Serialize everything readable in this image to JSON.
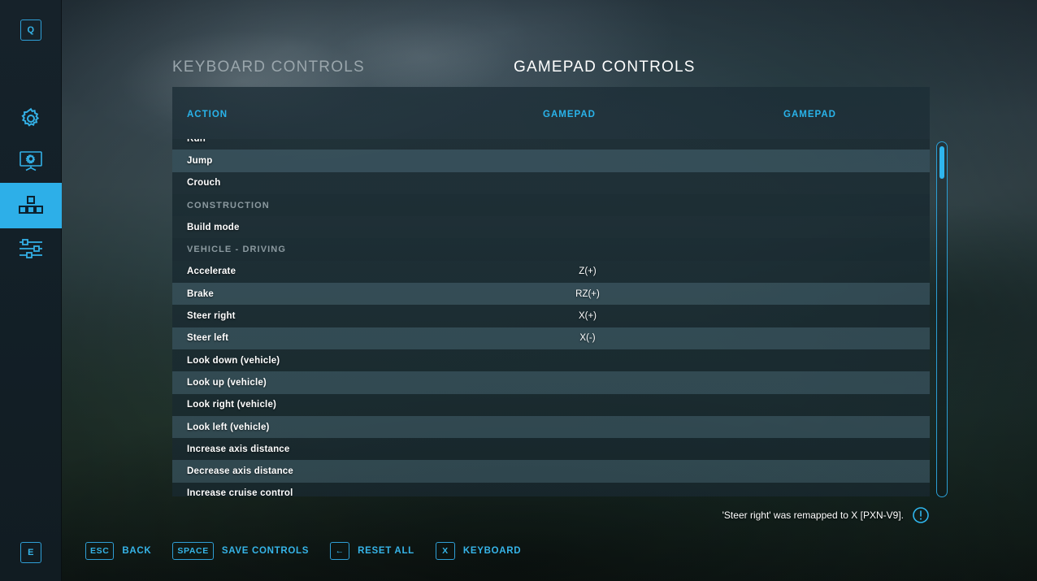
{
  "sidebar": {
    "top_key": "Q",
    "bottom_key": "E",
    "items": [
      {
        "name": "settings",
        "icon": "gear-icon",
        "active": false
      },
      {
        "name": "display",
        "icon": "monitor-gear-icon",
        "active": false
      },
      {
        "name": "controls",
        "icon": "controls-grid-icon",
        "active": true
      },
      {
        "name": "game-settings",
        "icon": "sliders-icon",
        "active": false
      }
    ]
  },
  "tabs": {
    "inactive_label": "KEYBOARD CONTROLS",
    "active_label": "GAMEPAD CONTROLS"
  },
  "table": {
    "headers": {
      "action": "ACTION",
      "gamepad_1": "GAMEPAD",
      "gamepad_2": "GAMEPAD"
    },
    "rows": [
      {
        "action": "Run",
        "value": "",
        "value2": "",
        "type": "binding",
        "shade": "dark",
        "clipped_top": true
      },
      {
        "action": "Jump",
        "value": "",
        "value2": "",
        "type": "binding",
        "shade": "lite"
      },
      {
        "action": "Crouch",
        "value": "",
        "value2": "",
        "type": "binding",
        "shade": "dark"
      },
      {
        "action": "CONSTRUCTION",
        "value": "",
        "value2": "",
        "type": "section",
        "shade": "section"
      },
      {
        "action": "Build mode",
        "value": "",
        "value2": "",
        "type": "binding",
        "shade": "dark"
      },
      {
        "action": "VEHICLE - DRIVING",
        "value": "",
        "value2": "",
        "type": "section",
        "shade": "section"
      },
      {
        "action": "Accelerate",
        "value": "Z(+)",
        "value2": "",
        "type": "binding",
        "shade": "dark"
      },
      {
        "action": "Brake",
        "value": "RZ(+)",
        "value2": "",
        "type": "binding",
        "shade": "lite"
      },
      {
        "action": "Steer right",
        "value": "X(+)",
        "value2": "",
        "type": "binding",
        "shade": "dark"
      },
      {
        "action": "Steer left",
        "value": "X(-)",
        "value2": "",
        "type": "binding",
        "shade": "lite"
      },
      {
        "action": "Look down (vehicle)",
        "value": "",
        "value2": "",
        "type": "binding",
        "shade": "dark"
      },
      {
        "action": "Look up (vehicle)",
        "value": "",
        "value2": "",
        "type": "binding",
        "shade": "lite"
      },
      {
        "action": "Look right (vehicle)",
        "value": "",
        "value2": "",
        "type": "binding",
        "shade": "dark"
      },
      {
        "action": "Look left (vehicle)",
        "value": "",
        "value2": "",
        "type": "binding",
        "shade": "lite"
      },
      {
        "action": "Increase axis distance",
        "value": "",
        "value2": "",
        "type": "binding",
        "shade": "dark"
      },
      {
        "action": "Decrease axis distance",
        "value": "",
        "value2": "",
        "type": "binding",
        "shade": "lite"
      },
      {
        "action": "Increase cruise control",
        "value": "",
        "value2": "",
        "type": "binding",
        "shade": "dark",
        "clipped_bottom": true
      }
    ]
  },
  "status": {
    "message": "'Steer right' was remapped to X [PXN-V9].",
    "icon": "warning-circle-icon"
  },
  "footer": {
    "actions": [
      {
        "key": "ESC",
        "label": "BACK"
      },
      {
        "key": "SPACE",
        "label": "SAVE CONTROLS"
      },
      {
        "key": "←",
        "label": "RESET ALL"
      },
      {
        "key": "X",
        "label": "KEYBOARD"
      }
    ]
  },
  "colors": {
    "accent": "#2dafe8",
    "accent_text": "#36b4e8",
    "header_blue": "#29b3ea",
    "row_light": "#567884",
    "text_white": "#ffffff",
    "section_grey": "#8c9aa0"
  }
}
